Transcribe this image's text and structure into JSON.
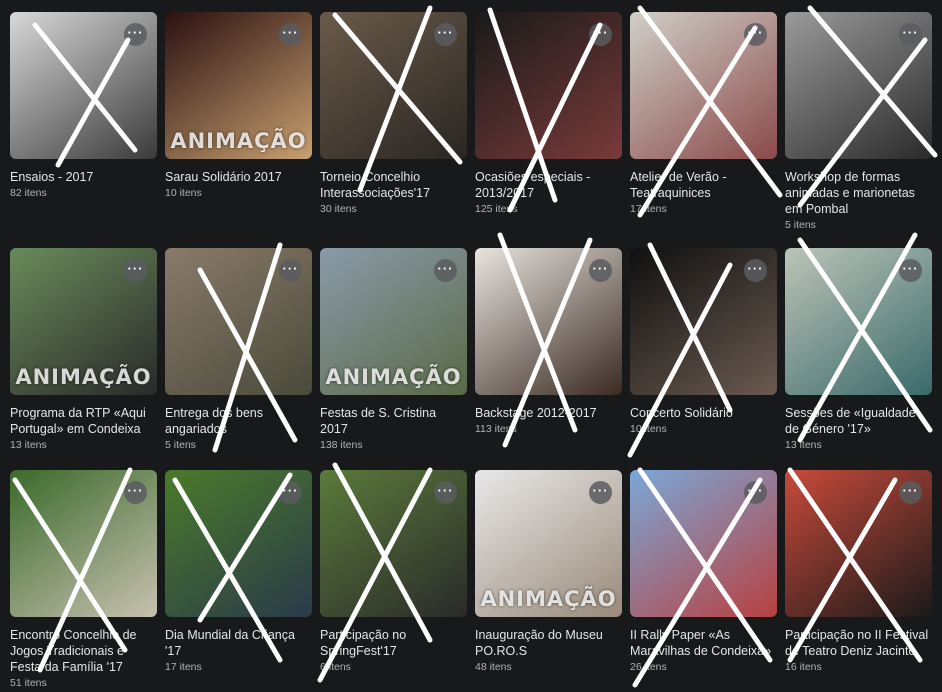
{
  "albums": [
    {
      "title": "Ensaios - 2017",
      "count": "82 itens",
      "badge": "",
      "icon": "more-options-icon",
      "c1": "#d8d8d8",
      "c2": "#3a3a3a"
    },
    {
      "title": "Sarau Solidário 2017",
      "count": "10 itens",
      "badge": "ANIMAÇÃO",
      "icon": "more-options-icon",
      "c1": "#2a1010",
      "c2": "#c8a070"
    },
    {
      "title": "Torneio Concelhio Interassociações'17",
      "count": "30 itens",
      "badge": "",
      "icon": "more-options-icon",
      "c1": "#6a5a4a",
      "c2": "#2a2622"
    },
    {
      "title": "Ocasiões especiais - 2013/2017",
      "count": "125 itens",
      "badge": "",
      "icon": "more-options-icon",
      "c1": "#1a1a1a",
      "c2": "#7a3a3a"
    },
    {
      "title": "Atelier de Verão - Teatraquinices",
      "count": "17 itens",
      "badge": "",
      "icon": "more-options-icon",
      "c1": "#d0cfc8",
      "c2": "#8a4a4a"
    },
    {
      "title": "Workshop de formas animadas e marionetas em Pombal",
      "count": "5 itens",
      "badge": "",
      "icon": "more-options-icon",
      "c1": "#9a9a9a",
      "c2": "#2a2a2a"
    },
    {
      "title": "Programa da RTP «Aqui Portugal» em Condeixa",
      "count": "13 itens",
      "badge": "ANIMAÇÃO",
      "icon": "more-options-icon",
      "c1": "#6a8a5a",
      "c2": "#2a2a2a"
    },
    {
      "title": "Entrega dos bens angariados",
      "count": "5 itens",
      "badge": "",
      "icon": "more-options-icon",
      "c1": "#8a7a6a",
      "c2": "#4a4a3a"
    },
    {
      "title": "Festas de S. Cristina 2017",
      "count": "138 itens",
      "badge": "ANIMAÇÃO",
      "icon": "more-options-icon",
      "c1": "#8a9aa8",
      "c2": "#5a6a48"
    },
    {
      "title": "Backstage 2012-2017",
      "count": "113 itens",
      "badge": "",
      "icon": "more-options-icon",
      "c1": "#e8e4de",
      "c2": "#3a2a22"
    },
    {
      "title": "Concerto Solidário",
      "count": "10 itens",
      "badge": "",
      "icon": "more-options-icon",
      "c1": "#101010",
      "c2": "#6a5a50"
    },
    {
      "title": "Sessões de «Igualdade de Género '17»",
      "count": "13 itens",
      "badge": "",
      "icon": "more-options-icon",
      "c1": "#bcc4b8",
      "c2": "#3a6a6a"
    },
    {
      "title": "Encontro Concelhio de Jogos Tradicionais e Festa da Família '17",
      "count": "51 itens",
      "badge": "",
      "icon": "more-options-icon",
      "c1": "#3a6a2a",
      "c2": "#c8c0b0"
    },
    {
      "title": "Dia Mundial da Criança '17",
      "count": "17 itens",
      "badge": "",
      "icon": "more-options-icon",
      "c1": "#4a7a2a",
      "c2": "#2a3a4a"
    },
    {
      "title": "Participação no SpringFest'17",
      "count": "6 itens",
      "badge": "",
      "icon": "more-options-icon",
      "c1": "#5a7a3a",
      "c2": "#2a2a2a"
    },
    {
      "title": "Inauguração do Museu PO.RO.S",
      "count": "48 itens",
      "badge": "ANIMAÇÃO",
      "icon": "more-options-icon",
      "c1": "#e8e8e8",
      "c2": "#9a8a7a"
    },
    {
      "title": "II Rally Paper «As Maravilhas de Condeixa»",
      "count": "26 itens",
      "badge": "",
      "icon": "more-options-icon",
      "c1": "#7aa8d8",
      "c2": "#b84040"
    },
    {
      "title": "Participação no II Festival de Teatro Deniz Jacinto",
      "count": "16 itens",
      "badge": "",
      "icon": "more-options-icon",
      "c1": "#c84a3a",
      "c2": "#1a1a1a"
    }
  ]
}
